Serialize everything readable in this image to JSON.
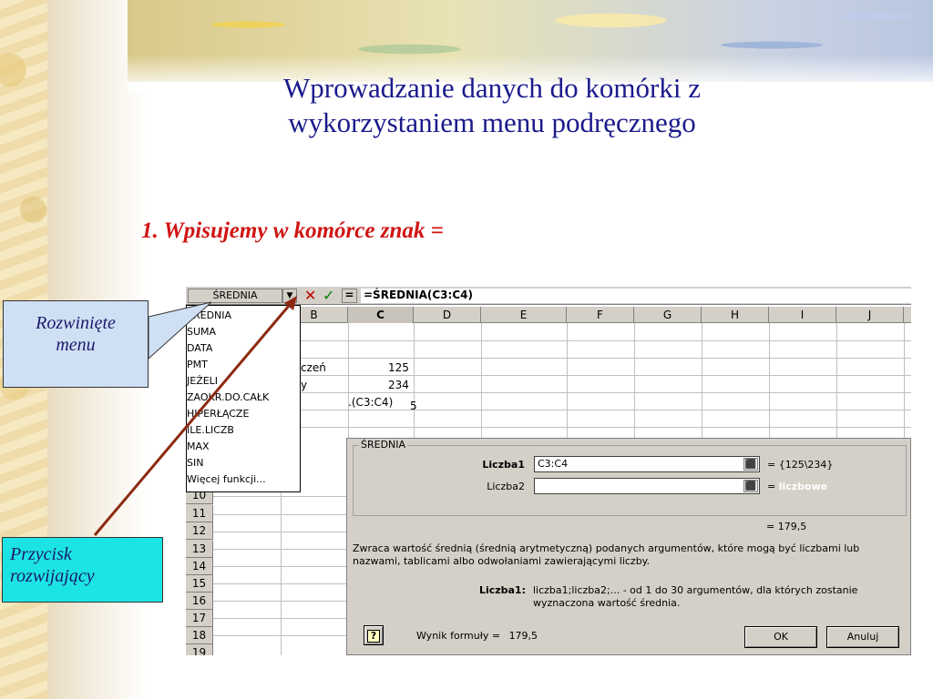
{
  "slide": {
    "title_line1": "Wprowadzanie danych do komórki z",
    "title_line2": "wykorzystaniem menu podręcznego",
    "subtitle": "1. Wpisujemy w komórce znak ="
  },
  "callouts": {
    "menu": [
      "Rozwinięte",
      "menu"
    ],
    "button": [
      "Przycisk",
      "rozwijający"
    ]
  },
  "excel": {
    "name_box": "ŚREDNIA",
    "name_arrow": "▼",
    "cancel_icon": "✕",
    "enter_icon": "✓",
    "equals_label": "=",
    "formula": "=ŚREDNIA(C3:C4)",
    "columns": [
      "B",
      "C",
      "D",
      "E",
      "F",
      "G",
      "H",
      "I",
      "J"
    ],
    "active_column": "C",
    "cells": {
      "b3": "czeń",
      "c3": "125",
      "b4": "y",
      "c4": "234",
      "c5": ".(C3:C4)",
      "d5": "5"
    },
    "rows": [
      "10",
      "11",
      "12",
      "13",
      "14",
      "15",
      "16",
      "17",
      "18",
      "19"
    ],
    "dropdown_items": [
      "ŚREDNIA",
      "SUMA",
      "DATA",
      "PMT",
      "JEŻELI",
      "ZAOKR.DO.CAŁK",
      "HIPERŁĄCZE",
      "ILE.LICZB",
      "MAX",
      "SIN",
      "Więcej funkcji..."
    ]
  },
  "dialog": {
    "group_title": "ŚREDNIA",
    "arg1_label": "Liczba1",
    "arg1_value": "C3:C4",
    "arg1_result": "= {125\\234}",
    "arg2_label": "Liczba2",
    "arg2_value": "",
    "arg2_result_eq": "=",
    "arg2_result": "liczbowe",
    "total_result": "= 179,5",
    "description": "Zwraca wartość średnią (średnią arytmetyczną) podanych argumentów, które mogą być liczbami lub nazwami, tablicami albo odwołaniami zawierającymi liczby.",
    "help_arg_label": "Liczba1:",
    "help_arg_text": "liczba1;liczba2;... - od 1 do 30 argumentów, dla których zostanie wyznaczona wartość średnia.",
    "help_icon": "?",
    "formula_result_label": "Wynik formuły =",
    "formula_result_value": "179,5",
    "ok_label": "OK",
    "cancel_label": "Anuluj",
    "range_button_icon": "⬛"
  }
}
